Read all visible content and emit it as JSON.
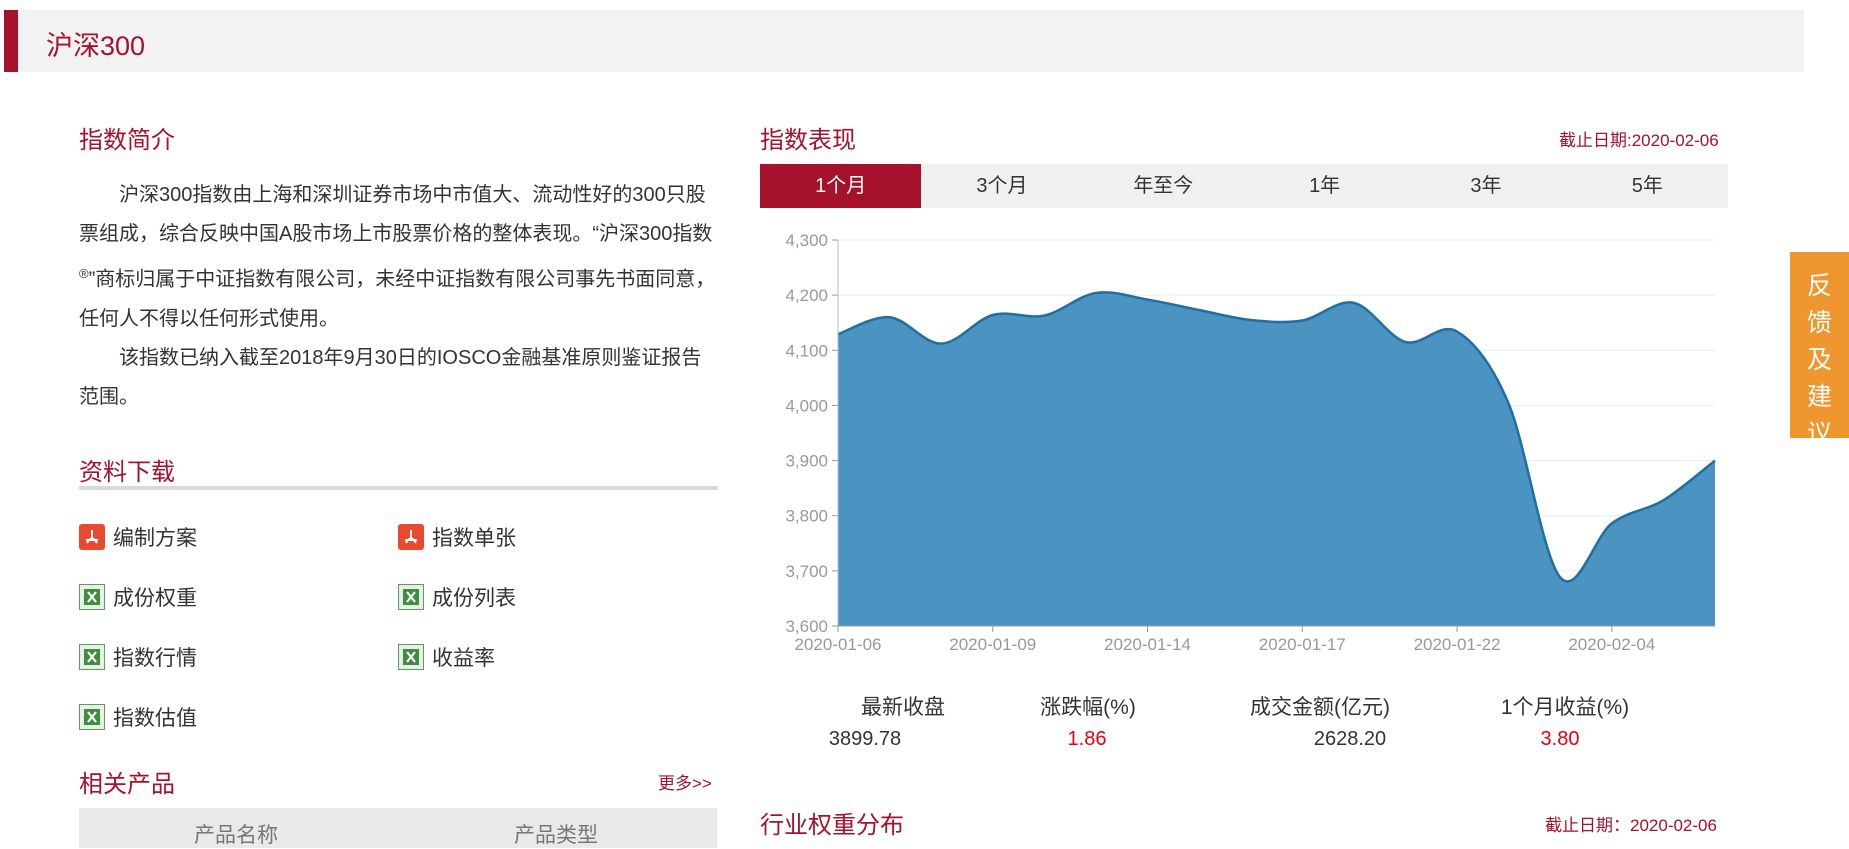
{
  "header": {
    "title": "沪深300"
  },
  "intro": {
    "title": "指数简介",
    "para1_a": "沪深300指数由上海和深圳证券市场中市值大、流动性好的300只股票组成，综合反映中国A股市场上市股票价格的整体表现。“沪深300指数",
    "para1_sup": "®",
    "para1_b": "”商标归属于中证指数有限公司，未经中证指数有限公司事先书面同意，任何人不得以任何形式使用。",
    "para2": "该指数已纳入截至2018年9月30日的IOSCO金融基准原则鉴证报告范围。"
  },
  "downloads": {
    "title": "资料下载",
    "items": [
      {
        "label": "编制方案",
        "icon": "pdf-icon"
      },
      {
        "label": "指数单张",
        "icon": "pdf-icon"
      },
      {
        "label": "成份权重",
        "icon": "excel-icon"
      },
      {
        "label": "成份列表",
        "icon": "excel-icon"
      },
      {
        "label": "指数行情",
        "icon": "excel-icon"
      },
      {
        "label": "收益率",
        "icon": "excel-icon"
      },
      {
        "label": "指数估值",
        "icon": "excel-icon"
      }
    ]
  },
  "related": {
    "title": "相关产品",
    "more": "更多>>",
    "columns": [
      "产品名称",
      "产品类型"
    ]
  },
  "performance": {
    "title": "指数表现",
    "date_note": "截止日期:2020-02-06",
    "tabs": [
      "1个月",
      "3个月",
      "年至今",
      "1年",
      "3年",
      "5年"
    ],
    "active_tab": 0
  },
  "stats": {
    "labels": [
      "最新收盘",
      "涨跌幅(%)",
      "成交金额(亿元)",
      "1个月收益(%)"
    ],
    "values": [
      "3899.78",
      "1.86",
      "2628.20",
      "3.80"
    ]
  },
  "industry": {
    "title": "行业权重分布",
    "date_note": "截止日期：2020-02-06"
  },
  "feedback": {
    "label": "反馈及建议"
  },
  "colors": {
    "brand": "#a6112b",
    "area_fill": "#4b93c1",
    "area_line": "#1f6fa3",
    "positive": "#e60012",
    "feedback_bg": "#f0962e"
  },
  "chart_data": {
    "type": "area",
    "x": [
      "2020-01-06",
      "2020-01-07",
      "2020-01-08",
      "2020-01-09",
      "2020-01-10",
      "2020-01-13",
      "2020-01-14",
      "2020-01-15",
      "2020-01-16",
      "2020-01-17",
      "2020-01-20",
      "2020-01-21",
      "2020-01-22",
      "2020-01-23",
      "2020-02-03",
      "2020-02-04",
      "2020-02-05",
      "2020-02-06"
    ],
    "x_tick_labels": [
      "2020-01-06",
      "2020-01-09",
      "2020-01-14",
      "2020-01-17",
      "2020-01-22",
      "2020-02-04"
    ],
    "series": [
      {
        "values": [
          4129,
          4160,
          4112,
          4164,
          4163,
          4204,
          4192,
          4173,
          4155,
          4154,
          4186,
          4115,
          4134,
          4003,
          3688,
          3786,
          3828,
          3900
        ]
      }
    ],
    "y_ticks": [
      "3,600",
      "3,700",
      "3,800",
      "3,900",
      "4,000",
      "4,100",
      "4,200",
      "4,300"
    ],
    "ylim": [
      3600,
      4300
    ],
    "grid": true,
    "legend": "none"
  }
}
